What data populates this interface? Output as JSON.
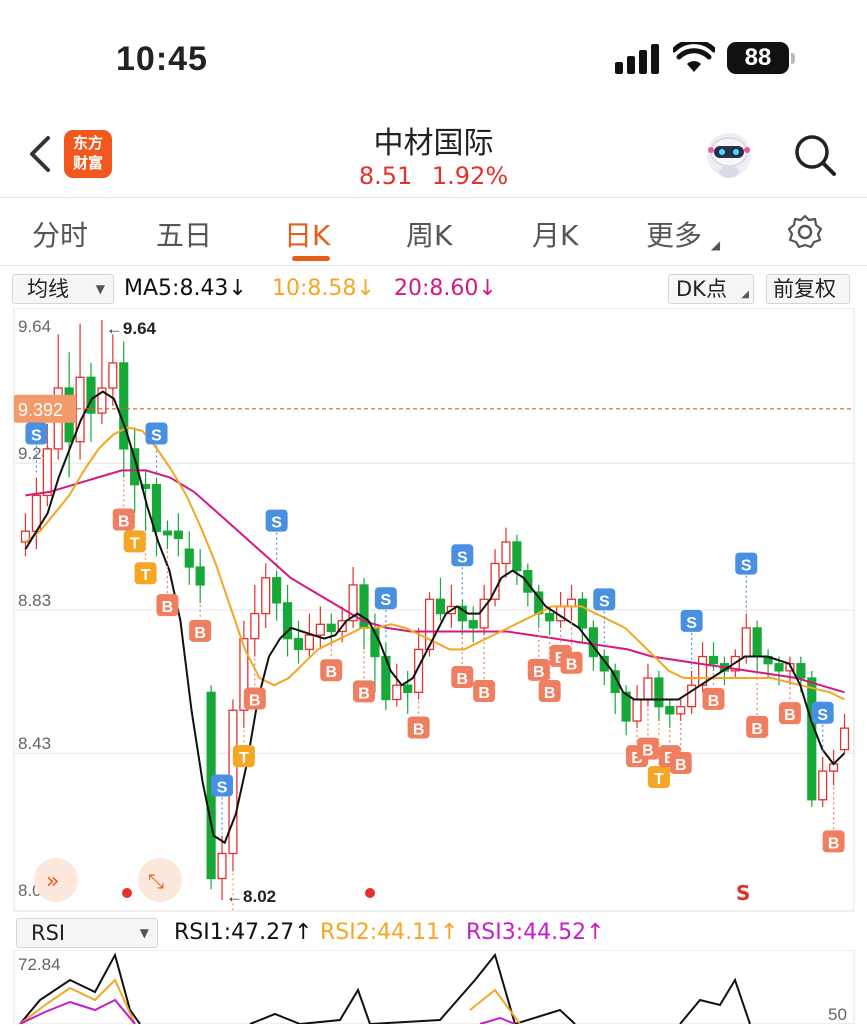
{
  "status_bar": {
    "time": "10:45",
    "battery": "88"
  },
  "header": {
    "logo_line1": "东方",
    "logo_line2": "财富",
    "stock_name": "中材国际",
    "price": "8.51",
    "change_pct": "1.92%"
  },
  "tabs": [
    {
      "label": "分时"
    },
    {
      "label": "五日"
    },
    {
      "label": "日K"
    },
    {
      "label": "周K"
    },
    {
      "label": "月K"
    },
    {
      "label": "更多"
    }
  ],
  "active_tab": "日K",
  "indicator_bar": {
    "selector": "均线",
    "ma5": "MA5:8.43",
    "ma10": "10:8.58",
    "ma20": "20:8.60",
    "arrow": "↓",
    "dk_button": "DK点",
    "adjust_button": "前复权"
  },
  "colors": {
    "up": "#e4312d",
    "down": "#16a838",
    "accent": "#e55f1a",
    "ma5": "#111111",
    "ma10": "#f5a623",
    "ma20": "#d6197e",
    "signal_s": "#4a90e2",
    "signal_b": "#f07f62",
    "signal_t": "#f5a623"
  },
  "chart_data": {
    "type": "candlestick",
    "y_ticks": [
      "9.64",
      "9.24",
      "8.83",
      "8.43",
      "8.02"
    ],
    "ylim": [
      8.02,
      9.64
    ],
    "current_line_label": "9.392",
    "high_label": "9.64",
    "low_label": "8.02",
    "candles": [
      [
        9.02,
        9.05,
        8.98,
        9.1
      ],
      [
        9.05,
        9.15,
        9.0,
        9.2
      ],
      [
        9.15,
        9.28,
        9.12,
        9.35
      ],
      [
        9.28,
        9.45,
        9.25,
        9.6
      ],
      [
        9.45,
        9.3,
        9.2,
        9.55
      ],
      [
        9.3,
        9.48,
        9.25,
        9.63
      ],
      [
        9.48,
        9.38,
        9.3,
        9.52
      ],
      [
        9.38,
        9.45,
        9.35,
        9.64
      ],
      [
        9.45,
        9.52,
        9.4,
        9.6
      ],
      [
        9.52,
        9.28,
        9.2,
        9.58
      ],
      [
        9.28,
        9.18,
        9.1,
        9.34
      ],
      [
        9.18,
        9.17,
        9.05,
        9.22
      ],
      [
        9.18,
        9.05,
        8.98,
        9.2
      ],
      [
        9.05,
        9.04,
        9.0,
        9.08
      ],
      [
        9.05,
        9.03,
        8.98,
        9.1
      ],
      [
        9.0,
        8.95,
        8.9,
        9.05
      ],
      [
        8.95,
        8.9,
        8.85,
        9.0
      ],
      [
        8.6,
        8.08,
        8.05,
        8.62
      ],
      [
        8.08,
        8.15,
        8.02,
        8.2
      ],
      [
        8.15,
        8.55,
        8.1,
        8.58
      ],
      [
        8.55,
        8.75,
        8.5,
        8.8
      ],
      [
        8.75,
        8.82,
        8.7,
        8.9
      ],
      [
        8.82,
        8.92,
        8.78,
        8.96
      ],
      [
        8.92,
        8.85,
        8.8,
        8.94
      ],
      [
        8.85,
        8.75,
        8.7,
        8.9
      ],
      [
        8.75,
        8.72,
        8.68,
        8.8
      ],
      [
        8.72,
        8.76,
        8.7,
        8.82
      ],
      [
        8.76,
        8.79,
        8.72,
        8.84
      ],
      [
        8.79,
        8.77,
        8.74,
        8.82
      ],
      [
        8.77,
        8.8,
        8.74,
        8.84
      ],
      [
        8.8,
        8.9,
        8.78,
        8.95
      ],
      [
        8.9,
        8.78,
        8.72,
        8.92
      ],
      [
        8.78,
        8.7,
        8.6,
        8.82
      ],
      [
        8.7,
        8.58,
        8.55,
        8.74
      ],
      [
        8.58,
        8.62,
        8.56,
        8.68
      ],
      [
        8.62,
        8.6,
        8.54,
        8.66
      ],
      [
        8.6,
        8.72,
        8.58,
        8.78
      ],
      [
        8.72,
        8.86,
        8.7,
        8.88
      ],
      [
        8.86,
        8.82,
        8.8,
        8.92
      ],
      [
        8.82,
        8.84,
        8.78,
        8.9
      ],
      [
        8.84,
        8.8,
        8.76,
        8.86
      ],
      [
        8.8,
        8.78,
        8.74,
        8.84
      ],
      [
        8.78,
        8.86,
        8.76,
        8.9
      ],
      [
        8.86,
        8.96,
        8.84,
        9.0
      ],
      [
        8.96,
        9.02,
        8.92,
        9.06
      ],
      [
        9.02,
        8.94,
        8.9,
        9.04
      ],
      [
        8.94,
        8.88,
        8.84,
        8.96
      ],
      [
        8.88,
        8.82,
        8.78,
        8.9
      ],
      [
        8.82,
        8.8,
        8.76,
        8.84
      ],
      [
        8.8,
        8.84,
        8.78,
        8.88
      ],
      [
        8.84,
        8.86,
        8.8,
        8.9
      ],
      [
        8.86,
        8.78,
        8.74,
        8.88
      ],
      [
        8.78,
        8.7,
        8.66,
        8.8
      ],
      [
        8.7,
        8.66,
        8.62,
        8.72
      ],
      [
        8.66,
        8.6,
        8.54,
        8.68
      ],
      [
        8.6,
        8.52,
        8.48,
        8.62
      ],
      [
        8.52,
        8.58,
        8.5,
        8.62
      ],
      [
        8.58,
        8.64,
        8.56,
        8.68
      ],
      [
        8.64,
        8.56,
        8.52,
        8.66
      ],
      [
        8.56,
        8.54,
        8.5,
        8.58
      ],
      [
        8.54,
        8.56,
        8.52,
        8.58
      ],
      [
        8.56,
        8.62,
        8.54,
        8.66
      ],
      [
        8.62,
        8.7,
        8.6,
        8.74
      ],
      [
        8.7,
        8.68,
        8.66,
        8.74
      ],
      [
        8.68,
        8.66,
        8.62,
        8.7
      ],
      [
        8.66,
        8.7,
        8.64,
        8.72
      ],
      [
        8.7,
        8.78,
        8.68,
        8.82
      ],
      [
        8.78,
        8.7,
        8.66,
        8.8
      ],
      [
        8.7,
        8.68,
        8.64,
        8.72
      ],
      [
        8.68,
        8.66,
        8.62,
        8.7
      ],
      [
        8.66,
        8.68,
        8.62,
        8.7
      ],
      [
        8.68,
        8.64,
        8.6,
        8.7
      ],
      [
        8.64,
        8.3,
        8.28,
        8.66
      ],
      [
        8.3,
        8.38,
        8.28,
        8.42
      ],
      [
        8.38,
        8.4,
        8.34,
        8.44
      ],
      [
        8.44,
        8.5,
        8.43,
        8.54
      ]
    ],
    "ma5": [
      9.0,
      9.05,
      9.1,
      9.2,
      9.28,
      9.36,
      9.42,
      9.44,
      9.42,
      9.34,
      9.24,
      9.12,
      9.02,
      8.94,
      8.8,
      8.55,
      8.35,
      8.2,
      8.18,
      8.26,
      8.4,
      8.58,
      8.7,
      8.75,
      8.78,
      8.77,
      8.76,
      8.75,
      8.76,
      8.8,
      8.82,
      8.8,
      8.74,
      8.66,
      8.62,
      8.64,
      8.7,
      8.76,
      8.82,
      8.84,
      8.82,
      8.82,
      8.86,
      8.92,
      8.94,
      8.92,
      8.88,
      8.84,
      8.82,
      8.8,
      8.78,
      8.74,
      8.7,
      8.66,
      8.6,
      8.58,
      8.58,
      8.58,
      8.58,
      8.58,
      8.6,
      8.62,
      8.64,
      8.66,
      8.68,
      8.7,
      8.7,
      8.7,
      8.69,
      8.68,
      8.62,
      8.52,
      8.44,
      8.4,
      8.43
    ],
    "ma10": [
      9.02,
      9.05,
      9.1,
      9.15,
      9.22,
      9.28,
      9.32,
      9.34,
      9.33,
      9.28,
      9.22,
      9.15,
      9.06,
      8.96,
      8.84,
      8.72,
      8.64,
      8.62,
      8.64,
      8.68,
      8.72,
      8.74,
      8.76,
      8.78,
      8.78,
      8.79,
      8.78,
      8.76,
      8.74,
      8.72,
      8.72,
      8.74,
      8.76,
      8.78,
      8.8,
      8.82,
      8.84,
      8.84,
      8.84,
      8.82,
      8.8,
      8.78,
      8.74,
      8.7,
      8.66,
      8.64,
      8.64,
      8.64,
      8.64,
      8.64,
      8.64,
      8.64,
      8.63,
      8.62,
      8.61,
      8.6,
      8.58
    ],
    "ma20": [
      9.15,
      9.16,
      9.18,
      9.2,
      9.22,
      9.22,
      9.2,
      9.16,
      9.1,
      9.04,
      8.98,
      8.92,
      8.88,
      8.84,
      8.8,
      8.78,
      8.77,
      8.77,
      8.77,
      8.77,
      8.77,
      8.76,
      8.75,
      8.74,
      8.73,
      8.72,
      8.7,
      8.69,
      8.68,
      8.67,
      8.66,
      8.65,
      8.64,
      8.62,
      8.6
    ],
    "signals": [
      "S",
      "B",
      "S",
      "T",
      "T",
      "B",
      "B",
      "S",
      "T",
      "T",
      "B",
      "S",
      "B",
      "B",
      "S",
      "B",
      "B",
      "B",
      "S",
      "B",
      "B",
      "B",
      "B",
      "S",
      "B",
      "B",
      "T",
      "B",
      "B",
      "S",
      "B",
      "S",
      "B",
      "B",
      "S",
      "B"
    ],
    "rsi": {
      "selector": "RSI",
      "rsi1": "RSI1:47.27",
      "rsi2": "RSI2:44.11",
      "rsi3": "RSI3:44.52",
      "arrow": "↑",
      "top_tick": "72.84",
      "right_tick": "50"
    }
  }
}
